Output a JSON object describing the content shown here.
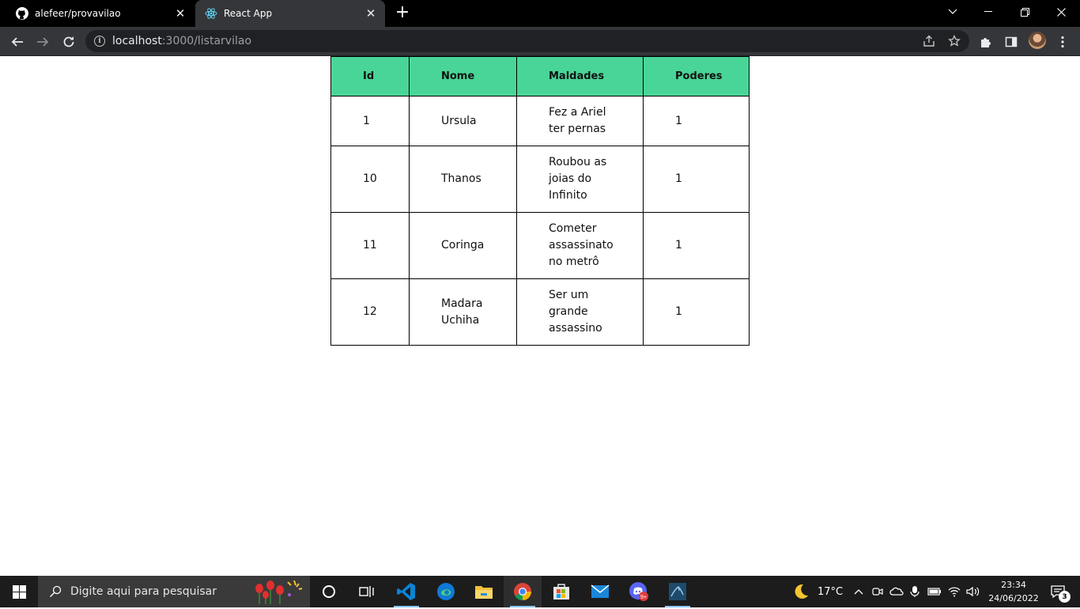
{
  "browser": {
    "tabs": [
      {
        "title": "alefeer/provavilao",
        "icon": "github-icon",
        "active": false
      },
      {
        "title": "React App",
        "icon": "react-icon",
        "active": true
      }
    ],
    "url_host": "localhost",
    "url_path": ":3000/listarvilao"
  },
  "table": {
    "header_color": "#48d597",
    "headers": {
      "id": "Id",
      "nome": "Nome",
      "maldades": "Maldades",
      "poderes": "Poderes"
    },
    "rows": [
      {
        "id": "1",
        "nome": "Ursula",
        "maldades": "Fez a Ariel ter pernas",
        "poderes": "1"
      },
      {
        "id": "10",
        "nome": "Thanos",
        "maldades": "Roubou as joias do Infinito",
        "poderes": "1"
      },
      {
        "id": "11",
        "nome": "Coringa",
        "maldades": "Cometer assassinato no metrô",
        "poderes": "1"
      },
      {
        "id": "12",
        "nome": "Madara Uchiha",
        "maldades": "Ser um grande assassino",
        "poderes": "1"
      }
    ]
  },
  "taskbar": {
    "search_placeholder": "Digite aqui para pesquisar",
    "apps": [
      "cortana-icon",
      "task-view-icon",
      "vscode-icon",
      "edge-icon",
      "file-explorer-icon",
      "chrome-icon",
      "store-icon",
      "mail-icon",
      "discord-icon",
      "mysql-workbench-icon"
    ],
    "weather_temp": "17°C",
    "time": "23:34",
    "date": "24/06/2022",
    "notification_count": "3"
  }
}
